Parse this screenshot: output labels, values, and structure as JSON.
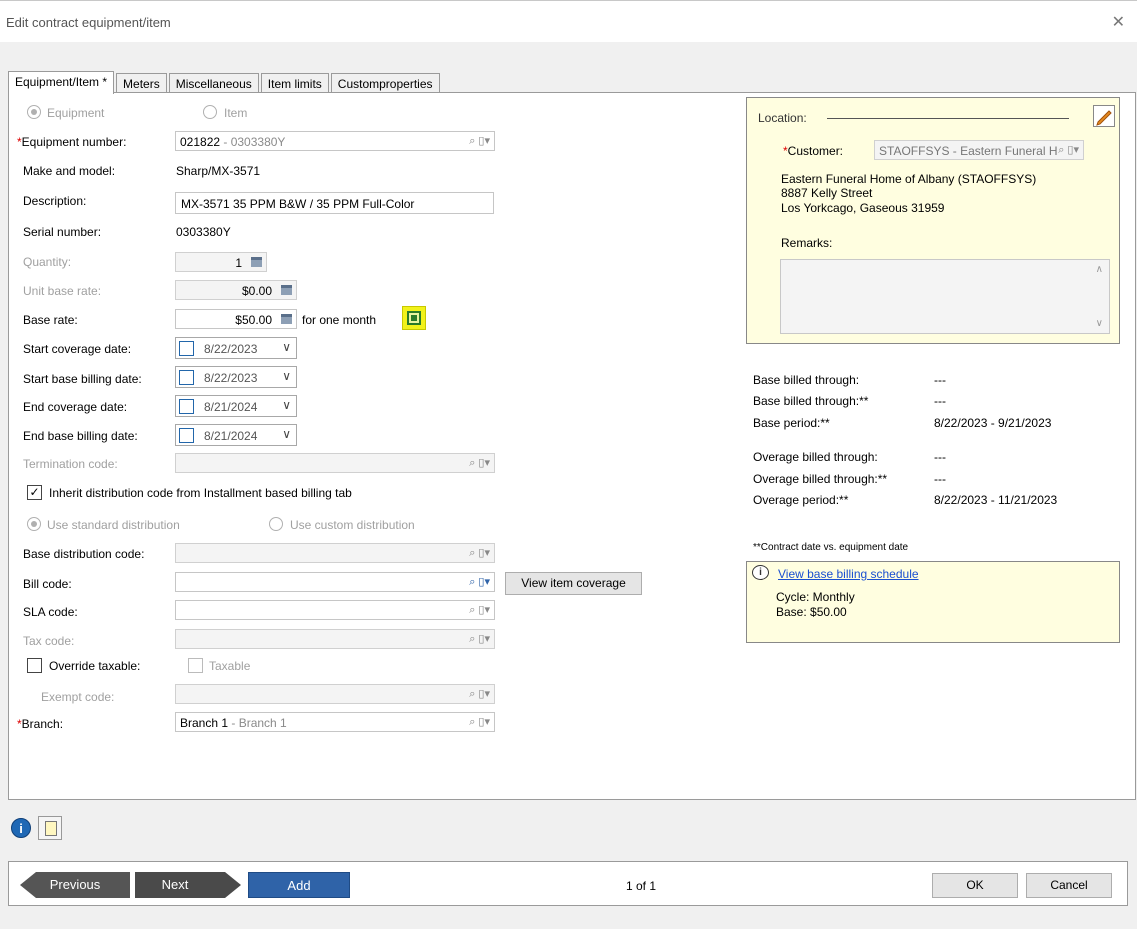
{
  "window": {
    "title": "Edit contract equipment/item",
    "close_glyph": "✕"
  },
  "tabs": [
    "Equipment/Item *",
    "Meters",
    "Miscellaneous",
    "Item limits",
    "Customproperties"
  ],
  "type_options": {
    "equipment": "Equipment",
    "item": "Item"
  },
  "labels": {
    "req_mark": "*",
    "equipment_number": "Equipment number:",
    "make_model": "Make and model:",
    "description": "Description:",
    "serial_number": "Serial number:",
    "quantity": "Quantity:",
    "unit_base_rate": "Unit base rate:",
    "base_rate": "Base rate:",
    "for_one_month": "for one month",
    "start_coverage_date": "Start coverage date:",
    "start_base_billing_date": "Start base billing date:",
    "end_coverage_date": "End coverage date:",
    "end_base_billing_date": "End base billing date:",
    "termination_code": "Termination code:",
    "inherit_distribution": "Inherit distribution code from Installment based billing tab",
    "use_standard_distribution": "Use standard distribution",
    "use_custom_distribution": "Use custom distribution",
    "base_distribution_code": "Base distribution code:",
    "bill_code": "Bill code:",
    "sla_code": "SLA code:",
    "tax_code": "Tax code:",
    "override_taxable": "Override taxable:",
    "taxable": "Taxable",
    "exempt_code": "Exempt code:",
    "branch": "Branch:"
  },
  "values": {
    "equipment_number": "021822",
    "equipment_number_desc": " - 0303380Y",
    "make_model": "Sharp/MX-3571",
    "description": "MX-3571 35 PPM B&W / 35 PPM Full-Color",
    "serial_number": "0303380Y",
    "quantity": "1",
    "unit_base_rate": "$0.00",
    "base_rate": "$50.00",
    "start_coverage_date": "8/22/2023",
    "start_base_billing_date": "8/22/2023",
    "end_coverage_date": "8/21/2024",
    "end_base_billing_date": "8/21/2024",
    "branch": "Branch 1",
    "branch_desc": " - Branch 1"
  },
  "buttons": {
    "view_item_coverage": "View item coverage"
  },
  "location": {
    "label": "Location:",
    "customer_label": "Customer:",
    "customer_value": "STAOFFSYS - Eastern Funeral H",
    "address_line1": "Eastern Funeral Home of Albany (STAOFFSYS)",
    "address_line2": "8887 Kelly Street",
    "address_line3": "Los Yorkcago, Gaseous 31959",
    "remarks_label": "Remarks:"
  },
  "billing": {
    "base_billed_through_label": "Base billed through:",
    "base_billed_through_value": "---",
    "base_billed_through2_label": "Base billed through:**",
    "base_billed_through2_value": "---",
    "base_period_label": "Base period:**",
    "base_period_value": "8/22/2023 - 9/21/2023",
    "overage_billed_through_label": "Overage billed through:",
    "overage_billed_through_value": "---",
    "overage_billed_through2_label": "Overage billed through:**",
    "overage_billed_through2_value": "---",
    "overage_period_label": "Overage period:**",
    "overage_period_value": "8/22/2023 - 11/21/2023",
    "note": "**Contract date vs. equipment date"
  },
  "schedule": {
    "link": "View base billing schedule",
    "cycle": "Cycle: Monthly",
    "base": "Base: $50.00"
  },
  "footer": {
    "previous": "Previous",
    "next": "Next",
    "add": "Add",
    "page": "1 of 1",
    "ok": "OK",
    "cancel": "Cancel"
  },
  "colors": {
    "accent_blue": "#2f63a8",
    "nav_dark": "#555555",
    "yellow_panel": "#fffee0",
    "required": "#dd0000"
  }
}
